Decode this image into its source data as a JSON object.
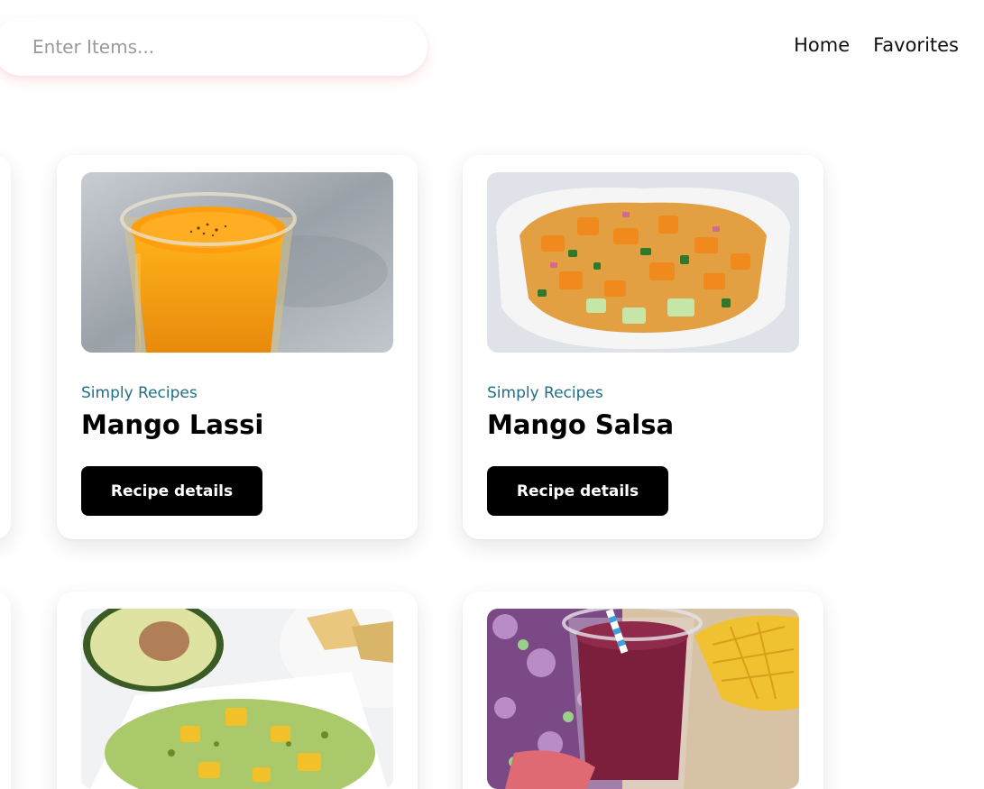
{
  "search": {
    "placeholder": "Enter Items..."
  },
  "nav": {
    "home": "Home",
    "favorites": "Favorites"
  },
  "cards": [
    {
      "source": "Simply Recipes",
      "title": "Mango Lassi",
      "button": "Recipe details",
      "image": "mango-lassi-photo"
    },
    {
      "source": "Simply Recipes",
      "title": "Mango Salsa",
      "button": "Recipe details",
      "image": "mango-salsa-photo"
    },
    {
      "image": "mango-guacamole-photo"
    },
    {
      "image": "berry-smoothie-photo"
    }
  ]
}
